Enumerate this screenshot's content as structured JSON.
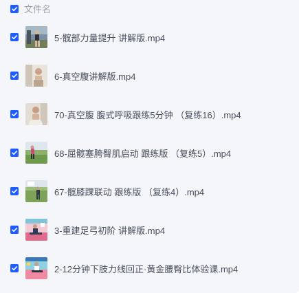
{
  "header": {
    "select_all_checked": true,
    "column_label": "文件名"
  },
  "files": [
    {
      "name": "5-髋部力量提升 讲解版.mp4",
      "checked": true,
      "thumb": "outdoor-exercise"
    },
    {
      "name": "6-真空腹讲解版.mp4",
      "checked": true,
      "thumb": "person-portrait"
    },
    {
      "name": "70-真空腹 腹式呼吸跟练5分钟 （复练16）.mp4",
      "checked": true,
      "thumb": "person-portrait"
    },
    {
      "name": "68-屈髋塞胯臀肌启动 跟练版 （复练5）.mp4",
      "checked": true,
      "thumb": "outdoor-exercise"
    },
    {
      "name": "67-髋膝踝联动 跟练版 （复练4）.mp4",
      "checked": true,
      "thumb": "outdoor-exercise"
    },
    {
      "name": "3-重建足弓初阶 讲解版.mp4",
      "checked": true,
      "thumb": "yoga-mat"
    },
    {
      "name": "2-12分钟下肢力线回正·黄金腰臀比体验课.mp4",
      "checked": true,
      "thumb": "yoga-mat"
    }
  ],
  "colors": {
    "checkbox": "#1f5cff",
    "panel_background": "#f5f6fa",
    "header_text": "#9aa0ab",
    "file_text": "#454d5a"
  }
}
